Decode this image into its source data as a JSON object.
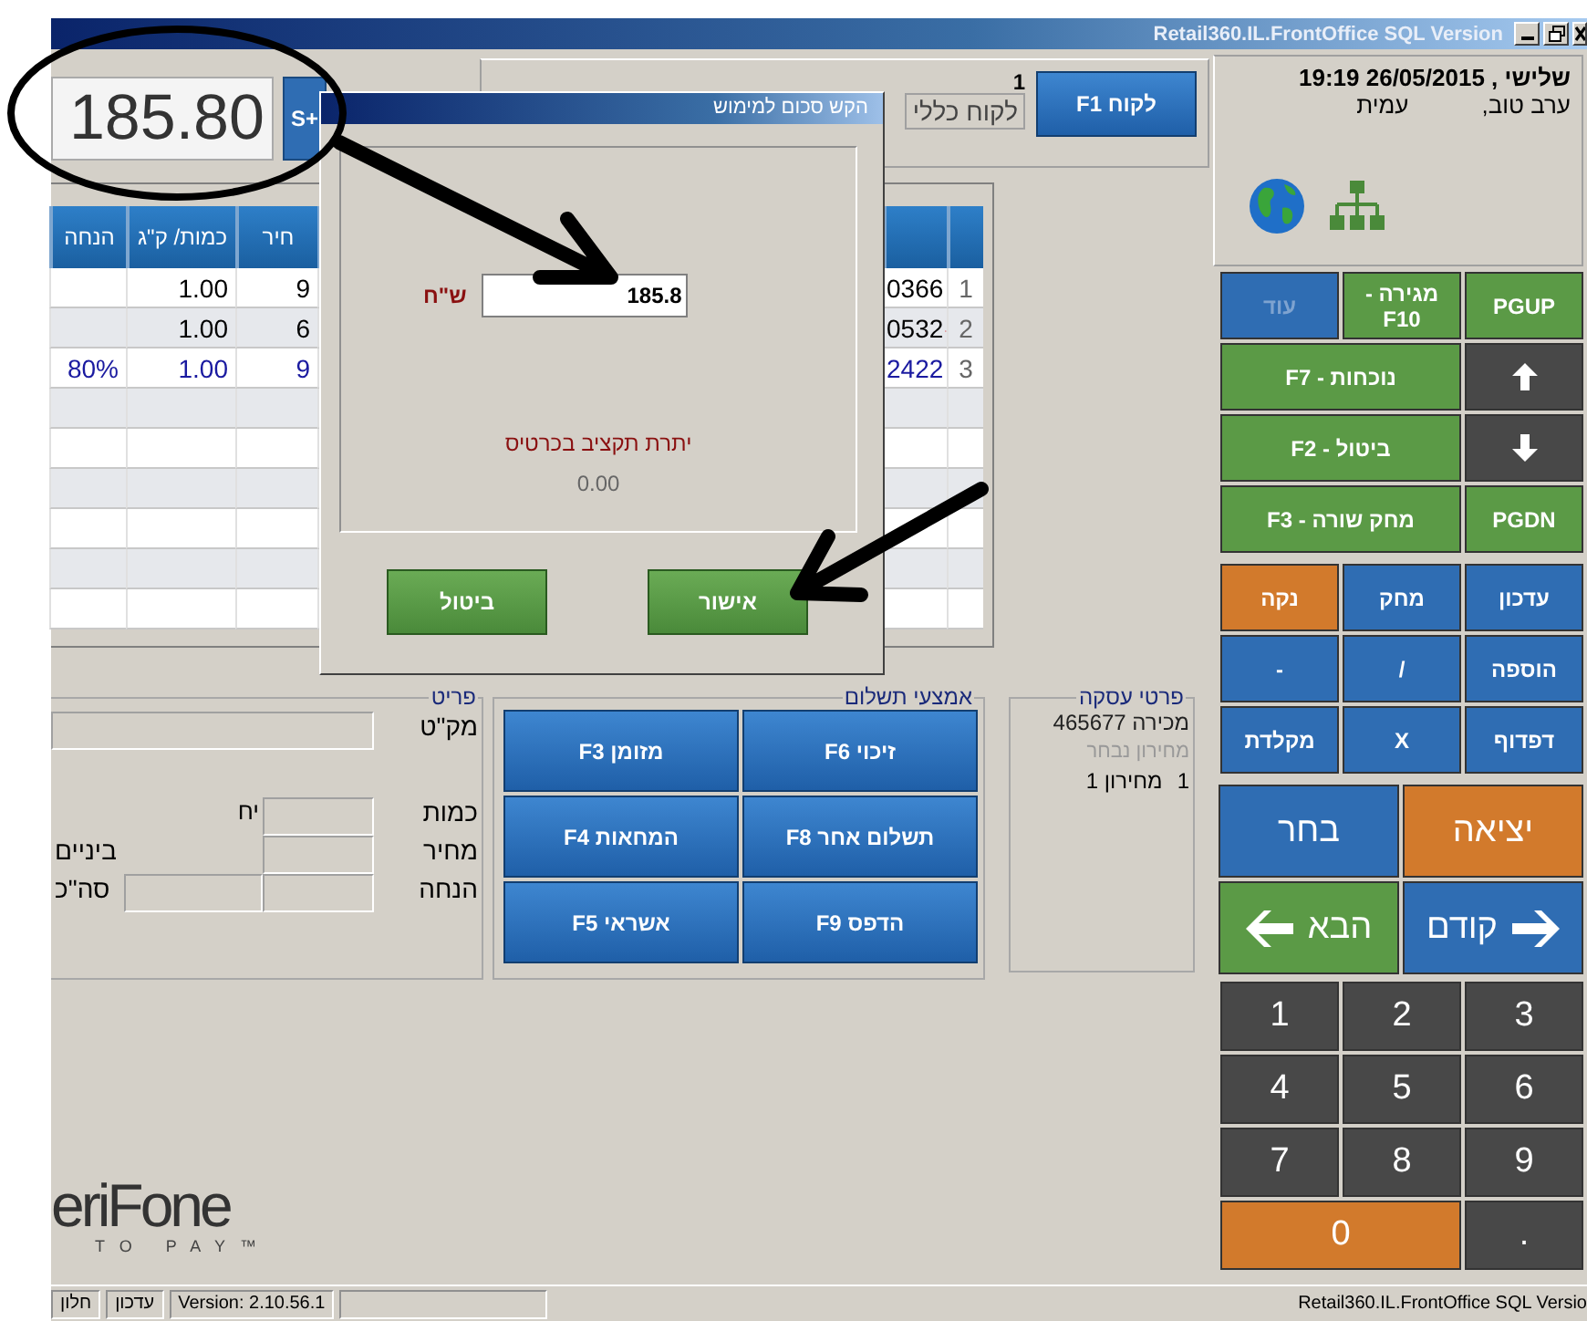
{
  "window": {
    "title": "Retail360.IL.FrontOffice SQL Version"
  },
  "total": {
    "value": "185.80",
    "button": "S+"
  },
  "customer": {
    "number": "1",
    "name": "לקוח כללי",
    "button": "לקוח F1"
  },
  "table": {
    "columns": [
      "חיר",
      "כמות/ ק\"ג",
      "הנחה"
    ],
    "rows": [
      {
        "number": "1",
        "code": "0366",
        "marked": false,
        "price": "9",
        "qty": "1.00",
        "highlighted": false
      },
      {
        "number": "2",
        "code": "0532",
        "marked": true,
        "price": "6",
        "qty": "1.00",
        "highlighted": false
      },
      {
        "number": "3",
        "code": "2422",
        "marked": false,
        "price": "9",
        "qty": "1.00",
        "discount": "80%",
        "highlighted": true
      }
    ]
  },
  "dialog": {
    "title": "הקש סכום למימוש",
    "currency_label": "ש\"ח",
    "amount": "185.8",
    "balance_label": "יתרת תקציב בכרטיס",
    "balance": "0.00",
    "buttons": [
      "אישור",
      "ביטול"
    ]
  },
  "item": {
    "title": "פריט",
    "sku_label": "מק\"ט",
    "qty_label": "כמות",
    "unit": "יח",
    "price_label": "מחיר",
    "subtotal_label": "ביניים",
    "discount_label": "הנחה",
    "total_label": "סה\"כ"
  },
  "payment": {
    "title": "אמצעי תשלום",
    "buttons": [
      "זיכוי F6",
      "מזומן F3",
      "תשלום אחר F8",
      "המחאות F4",
      "הדפס F9",
      "אשראי F5"
    ]
  },
  "transaction": {
    "title": "פרטי עסקה",
    "sale": "מכירה 465677",
    "price_list_label": "מחירון נבחר",
    "price_list_number": "1",
    "price_list": "מחירון 1"
  },
  "info": {
    "datetime": "שלישי , 26/05/2015 19:19",
    "greeting": "ערב טוב,",
    "user": "עמית"
  },
  "keys": [
    {
      "kind": "text",
      "label": "PGUP",
      "color": "#5b9a46",
      "wide": false,
      "disabled": false
    },
    {
      "kind": "text",
      "label": "מגירה - F10",
      "color": "#5b9a46",
      "wide": false,
      "disabled": false
    },
    {
      "kind": "text",
      "label": "עוד",
      "color": "#2f6db3",
      "wide": false,
      "disabled": true
    },
    {
      "kind": "up",
      "color": "#484848",
      "wide": false,
      "disabled": false
    },
    {
      "kind": "text",
      "label": "נוכחות - F7",
      "color": "#5b9a46",
      "wide": true,
      "disabled": false
    },
    {
      "kind": "down",
      "color": "#484848",
      "wide": false,
      "disabled": false
    },
    {
      "kind": "text",
      "label": "ביטול - F2",
      "color": "#5b9a46",
      "wide": true,
      "disabled": false
    },
    {
      "kind": "text",
      "label": "PGDN",
      "color": "#5b9a46",
      "wide": false,
      "disabled": false
    },
    {
      "kind": "text",
      "label": "מחק שורה - F3",
      "color": "#5b9a46",
      "wide": true,
      "disabled": false
    }
  ],
  "edit_keys": [
    {
      "label": "עדכון",
      "color": "#2f6db3"
    },
    {
      "label": "מחק",
      "color": "#2f6db3"
    },
    {
      "label": "נקה",
      "color": "#d27a2c"
    },
    {
      "label": "הוספה",
      "color": "#2f6db3"
    },
    {
      "label": "/",
      "color": "#2f6db3"
    },
    {
      "label": "-",
      "color": "#2f6db3"
    },
    {
      "label": "דפדוף",
      "color": "#2f6db3"
    },
    {
      "label": "X",
      "color": "#2f6db3"
    },
    {
      "label": "מקלדת",
      "color": "#2f6db3"
    }
  ],
  "nav_keys": [
    {
      "kind": "plain",
      "label": "יציאה",
      "color": "#d27a2c"
    },
    {
      "kind": "plain",
      "label": "בחר",
      "color": "#2f6db3"
    },
    {
      "kind": "right-arrow",
      "label": "קודם",
      "color": "#2f6db3"
    },
    {
      "kind": "left-arrow",
      "label": "הבא",
      "color": "#5b9a46"
    }
  ],
  "numpad": [
    {
      "label": "3",
      "color": "#484848",
      "wide": false
    },
    {
      "label": "2",
      "color": "#484848",
      "wide": false
    },
    {
      "label": "1",
      "color": "#484848",
      "wide": false
    },
    {
      "label": "6",
      "color": "#484848",
      "wide": false
    },
    {
      "label": "5",
      "color": "#484848",
      "wide": false
    },
    {
      "label": "4",
      "color": "#484848",
      "wide": false
    },
    {
      "label": "9",
      "color": "#484848",
      "wide": false
    },
    {
      "label": "8",
      "color": "#484848",
      "wide": false
    },
    {
      "label": "7",
      "color": "#484848",
      "wide": false
    },
    {
      "label": ".",
      "color": "#484848",
      "wide": false
    },
    {
      "label": "0",
      "color": "#d27a2c",
      "wide": true
    }
  ],
  "logo": {
    "name": "eriFone",
    "tagline": "TO PAY™"
  },
  "status_bar": {
    "panels": [
      "Version: 2.10.56.1",
      "עדכון",
      "חלון"
    ],
    "app": "Retail360.IL.FrontOffice SQL Versio"
  }
}
